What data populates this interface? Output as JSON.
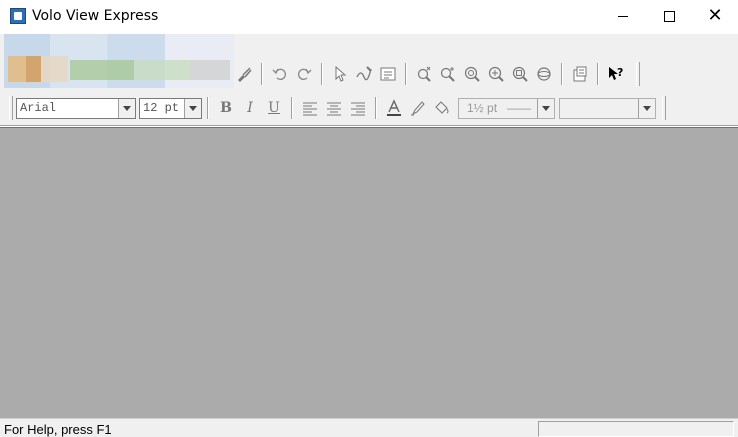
{
  "window": {
    "title": "Volo View Express",
    "minimize_label": "—",
    "maximize_label": "☐",
    "close_label": "✕"
  },
  "toolbar": {
    "font_name": "Arial",
    "font_size": "12 pt",
    "bold": "B",
    "italic": "I",
    "underline": "U",
    "line_width": "1½ pt",
    "line_style": "——",
    "color_combo": "",
    "help_icon_text": "?"
  },
  "icons": {
    "undo": "undo-icon",
    "redo": "redo-icon",
    "select": "arrow-pointer-icon",
    "markup": "pen-markup-icon",
    "text": "text-box-icon",
    "zoom_realtime": "zoom-realtime-icon",
    "zoom_in": "zoom-in-icon",
    "zoom_out": "zoom-out-icon",
    "zoom_window": "zoom-window-icon",
    "zoom_extents": "zoom-extents-icon",
    "orbit": "orbit-icon",
    "properties": "properties-icon",
    "whats_this": "whats-this-help-icon"
  },
  "status": {
    "help_text": "For Help, press F1"
  }
}
